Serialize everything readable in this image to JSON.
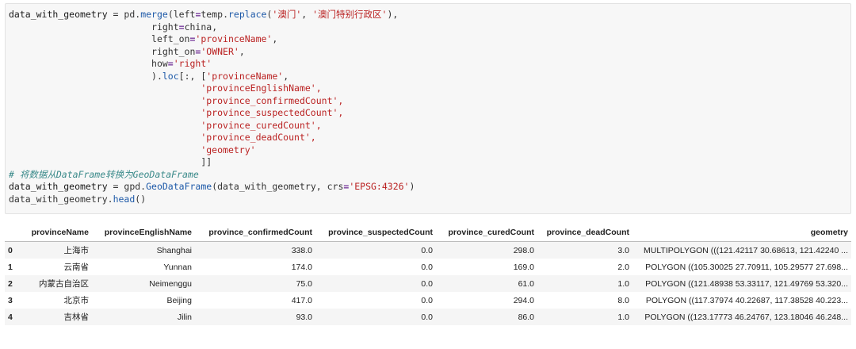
{
  "code": {
    "line1": {
      "var": "data_with_geometry",
      "eq": " = ",
      "call": "pd.",
      "fn": "merge",
      "open": "(left",
      "eq2": "=",
      "arg": "temp.",
      "fn2": "replace",
      "p": "(",
      "s1": "'澳门'",
      "comma": ", ",
      "s2": "'澳门特别行政区'",
      "close": "),"
    },
    "line2": {
      "indent": "                          ",
      "key": "right",
      "eq": "=",
      "val": "china,"
    },
    "line3": {
      "indent": "                          ",
      "key": "left_on",
      "eq": "=",
      "val": "'provinceName'",
      "end": ","
    },
    "line4": {
      "indent": "                          ",
      "key": "right_on",
      "eq": "=",
      "val": "'OWNER'",
      "end": ","
    },
    "line5": {
      "indent": "                          ",
      "key": "how",
      "eq": "=",
      "val": "'right'"
    },
    "line6": {
      "indent": "                          ",
      "pre": ").",
      "fn": "loc",
      "post": "[:, [",
      "val": "'provinceName'",
      "end": ","
    },
    "cols": [
      "'provinceEnglishName',",
      "'province_confirmedCount',",
      "'province_suspectedCount',",
      "'province_curedCount',",
      "'province_deadCount',",
      "'geometry'",
      "]]"
    ],
    "colIndent": "                                   ",
    "comment": "# 将数据从DataFrame转换为GeoDataFrame",
    "line_gdf": {
      "var": "data_with_geometry",
      "eq": " = ",
      "mod": "gpd.",
      "fn": "GeoDataFrame",
      "args": "(data_with_geometry, crs",
      "eq2": "=",
      "str": "'EPSG:4326'",
      "close": ")"
    },
    "line_head": {
      "var": "data_with_geometry.",
      "fn": "head",
      "close": "()"
    }
  },
  "table": {
    "columns": [
      "provinceName",
      "provinceEnglishName",
      "province_confirmedCount",
      "province_suspectedCount",
      "province_curedCount",
      "province_deadCount",
      "geometry"
    ],
    "rows": [
      {
        "idx": "0",
        "cells": [
          "上海市",
          "Shanghai",
          "338.0",
          "0.0",
          "298.0",
          "3.0",
          "MULTIPOLYGON (((121.42117 30.68613, 121.42240 ..."
        ]
      },
      {
        "idx": "1",
        "cells": [
          "云南省",
          "Yunnan",
          "174.0",
          "0.0",
          "169.0",
          "2.0",
          "POLYGON ((105.30025 27.70911, 105.29577 27.698..."
        ]
      },
      {
        "idx": "2",
        "cells": [
          "内蒙古自治区",
          "Neimenggu",
          "75.0",
          "0.0",
          "61.0",
          "1.0",
          "POLYGON ((121.48938 53.33117, 121.49769 53.320..."
        ]
      },
      {
        "idx": "3",
        "cells": [
          "北京市",
          "Beijing",
          "417.0",
          "0.0",
          "294.0",
          "8.0",
          "POLYGON ((117.37974 40.22687, 117.38528 40.223..."
        ]
      },
      {
        "idx": "4",
        "cells": [
          "吉林省",
          "Jilin",
          "93.0",
          "0.0",
          "86.0",
          "1.0",
          "POLYGON ((123.17773 46.24767, 123.18046 46.248..."
        ]
      }
    ]
  }
}
